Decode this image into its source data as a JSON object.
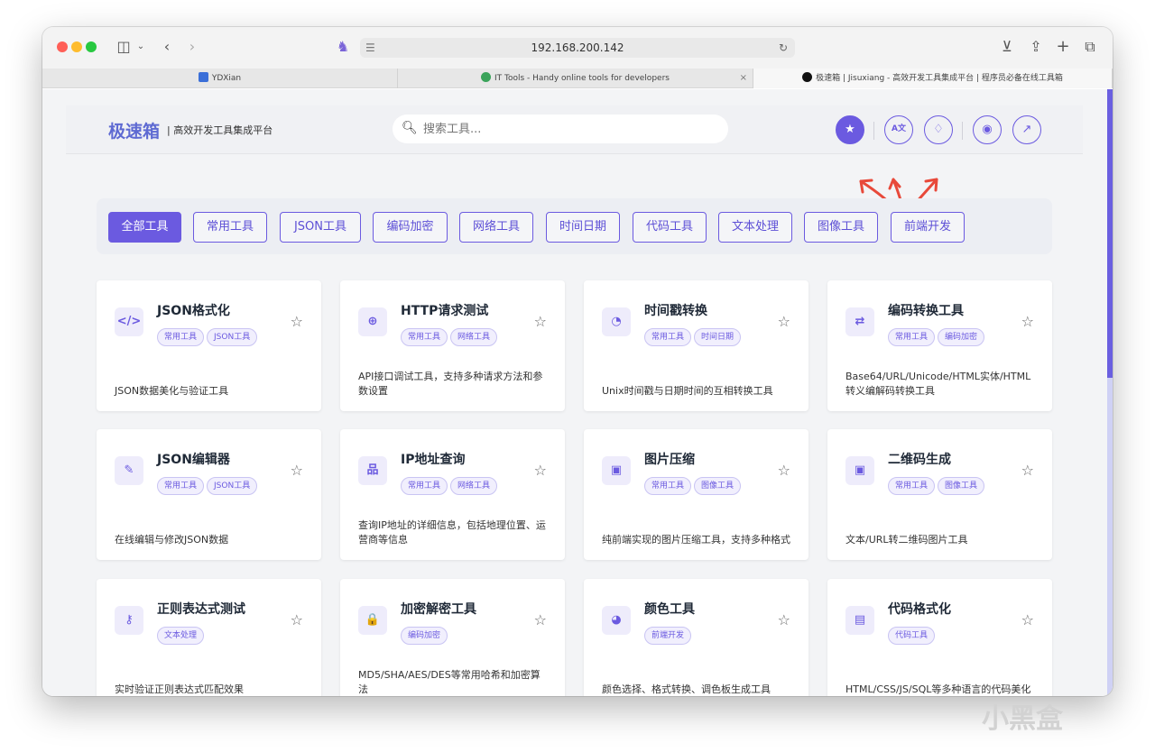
{
  "browser": {
    "address": "192.168.200.142",
    "tabs": [
      {
        "label": "YDXian"
      },
      {
        "label": "IT Tools - Handy online tools for developers"
      },
      {
        "label": "极速箱 | Jisuxiang - 高效开发工具集成平台 | 程序员必备在线工具箱"
      }
    ],
    "tab_close_glyph": "×"
  },
  "header": {
    "logo": "极速箱",
    "tagline": "| 高效开发工具集成平台",
    "search_placeholder": "搜索工具...",
    "buttons": [
      {
        "name": "favorites-button",
        "icon": "star-icon",
        "glyph": "★"
      },
      {
        "name": "language-button",
        "icon": "translate-icon",
        "glyph": "A文"
      },
      {
        "name": "suggestion-button",
        "icon": "lightbulb-icon",
        "glyph": "♢"
      },
      {
        "name": "github-button",
        "icon": "github-icon",
        "glyph": "◉"
      },
      {
        "name": "external-link-button",
        "icon": "external-link-icon",
        "glyph": "↗"
      }
    ]
  },
  "categories": [
    "全部工具",
    "常用工具",
    "JSON工具",
    "编码加密",
    "网络工具",
    "时间日期",
    "代码工具",
    "文本处理",
    "图像工具",
    "前端开发"
  ],
  "active_category": "全部工具",
  "tools": [
    {
      "title": "JSON格式化",
      "icon": "code-icon",
      "glyph": "</>",
      "tags": [
        "常用工具",
        "JSON工具"
      ],
      "desc": "JSON数据美化与验证工具"
    },
    {
      "title": "HTTP请求测试",
      "icon": "globe-icon",
      "glyph": "⊕",
      "tags": [
        "常用工具",
        "网络工具"
      ],
      "desc": "API接口调试工具，支持多种请求方法和参数设置"
    },
    {
      "title": "时间戳转换",
      "icon": "clock-icon",
      "glyph": "◔",
      "tags": [
        "常用工具",
        "时间日期"
      ],
      "desc": "Unix时间戳与日期时间的互相转换工具"
    },
    {
      "title": "编码转换工具",
      "icon": "exchange-icon",
      "glyph": "⇄",
      "tags": [
        "常用工具",
        "编码加密"
      ],
      "desc": "Base64/URL/Unicode/HTML实体/HTML转义编解码转换工具"
    },
    {
      "title": "JSON编辑器",
      "icon": "edit-icon",
      "glyph": "✎",
      "tags": [
        "常用工具",
        "JSON工具"
      ],
      "desc": "在线编辑与修改JSON数据"
    },
    {
      "title": "IP地址查询",
      "icon": "network-icon",
      "glyph": "品",
      "tags": [
        "常用工具",
        "网络工具"
      ],
      "desc": "查询IP地址的详细信息，包括地理位置、运营商等信息"
    },
    {
      "title": "图片压缩",
      "icon": "image-icon",
      "glyph": "▣",
      "tags": [
        "常用工具",
        "图像工具"
      ],
      "desc": "纯前端实现的图片压缩工具，支持多种格式"
    },
    {
      "title": "二维码生成",
      "icon": "image-icon",
      "glyph": "▣",
      "tags": [
        "常用工具",
        "图像工具"
      ],
      "desc": "文本/URL转二维码图片工具"
    },
    {
      "title": "正则表达式测试",
      "icon": "key-icon",
      "glyph": "⚷",
      "tags": [
        "文本处理"
      ],
      "desc": "实时验证正则表达式匹配效果"
    },
    {
      "title": "加密解密工具",
      "icon": "lock-icon",
      "glyph": "🔒",
      "tags": [
        "编码加密"
      ],
      "desc": "MD5/SHA/AES/DES等常用哈希和加密算法"
    },
    {
      "title": "颜色工具",
      "icon": "palette-icon",
      "glyph": "◕",
      "tags": [
        "前端开发"
      ],
      "desc": "颜色选择、格式转换、调色板生成工具"
    },
    {
      "title": "代码格式化",
      "icon": "code-file-icon",
      "glyph": "▤",
      "tags": [
        "代码工具"
      ],
      "desc": "HTML/CSS/JS/SQL等多种语言的代码美化"
    }
  ],
  "watermark": "小黑盒",
  "colors": {
    "accent": "#6b5ae0",
    "logo": "#5e6ad2",
    "annotation": "#e8493a"
  }
}
